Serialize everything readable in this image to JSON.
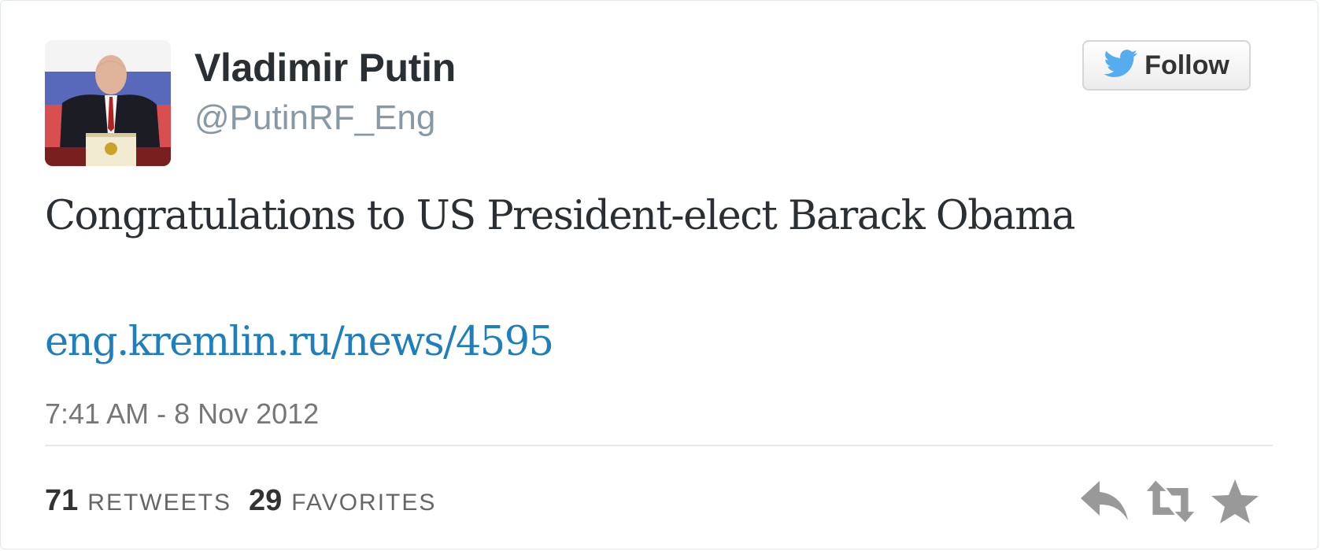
{
  "user": {
    "display_name": "Vladimir Putin",
    "handle": "@PutinRF_Eng"
  },
  "follow_button": {
    "label": "Follow",
    "icon": "twitter-bird-icon"
  },
  "tweet": {
    "text": "Congratulations to US President-elect Barack Obama",
    "link": "eng.kremlin.ru/news/4595",
    "timestamp": "7:41 AM - 8 Nov 2012"
  },
  "stats": {
    "retweets_count": "71",
    "retweets_label": "RETWEETS",
    "favorites_count": "29",
    "favorites_label": "FAVORITES"
  },
  "actions": {
    "reply_icon": "reply-icon",
    "retweet_icon": "retweet-icon",
    "favorite_icon": "star-icon"
  },
  "colors": {
    "link": "#1f7fbd",
    "twitter_blue": "#55acee",
    "action_gray": "#999999"
  }
}
